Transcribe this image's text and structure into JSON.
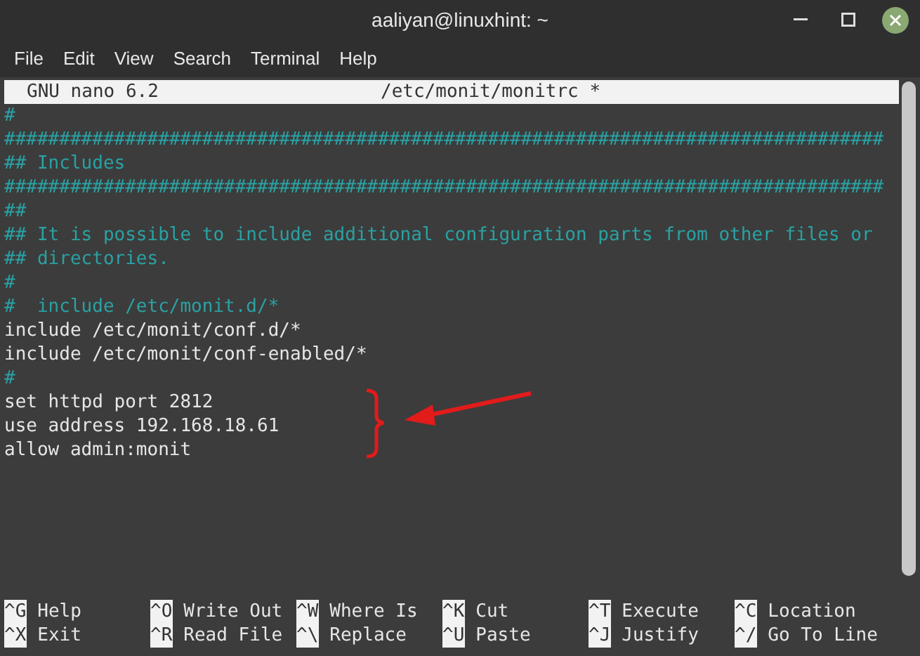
{
  "window": {
    "title": "aaliyan@linuxhint: ~"
  },
  "menu": [
    "File",
    "Edit",
    "View",
    "Search",
    "Terminal",
    "Help"
  ],
  "nano_header": {
    "version": "GNU nano 6.2",
    "file": "/etc/monit/monitrc *"
  },
  "lines": [
    {
      "kind": "comment",
      "text": "#"
    },
    {
      "kind": "comment",
      "text": "################################################################################"
    },
    {
      "kind": "comment",
      "text": "## Includes"
    },
    {
      "kind": "comment",
      "text": "################################################################################"
    },
    {
      "kind": "comment",
      "text": "##"
    },
    {
      "kind": "comment",
      "text": "## It is possible to include additional configuration parts from other files or"
    },
    {
      "kind": "comment",
      "text": "## directories."
    },
    {
      "kind": "comment",
      "text": "#"
    },
    {
      "kind": "comment",
      "text": "#  include /etc/monit.d/*"
    },
    {
      "kind": "code",
      "text": "include /etc/monit/conf.d/*"
    },
    {
      "kind": "code",
      "text": "include /etc/monit/conf-enabled/*"
    },
    {
      "kind": "comment",
      "text": "#"
    },
    {
      "kind": "code",
      "text": "set httpd port 2812"
    },
    {
      "kind": "code",
      "text": "use address 192.168.18.61"
    },
    {
      "kind": "code",
      "text": "allow admin:monit"
    }
  ],
  "shortcuts": [
    [
      {
        "key": "^G",
        "label": "Help"
      },
      {
        "key": "^O",
        "label": "Write Out"
      },
      {
        "key": "^W",
        "label": "Where Is"
      },
      {
        "key": "^K",
        "label": "Cut"
      },
      {
        "key": "^T",
        "label": "Execute"
      },
      {
        "key": "^C",
        "label": "Location"
      }
    ],
    [
      {
        "key": "^X",
        "label": "Exit"
      },
      {
        "key": "^R",
        "label": "Read File"
      },
      {
        "key": "^\\",
        "label": "Replace"
      },
      {
        "key": "^U",
        "label": "Paste"
      },
      {
        "key": "^J",
        "label": "Justify"
      },
      {
        "key": "^/",
        "label": "Go To Line"
      }
    ]
  ]
}
